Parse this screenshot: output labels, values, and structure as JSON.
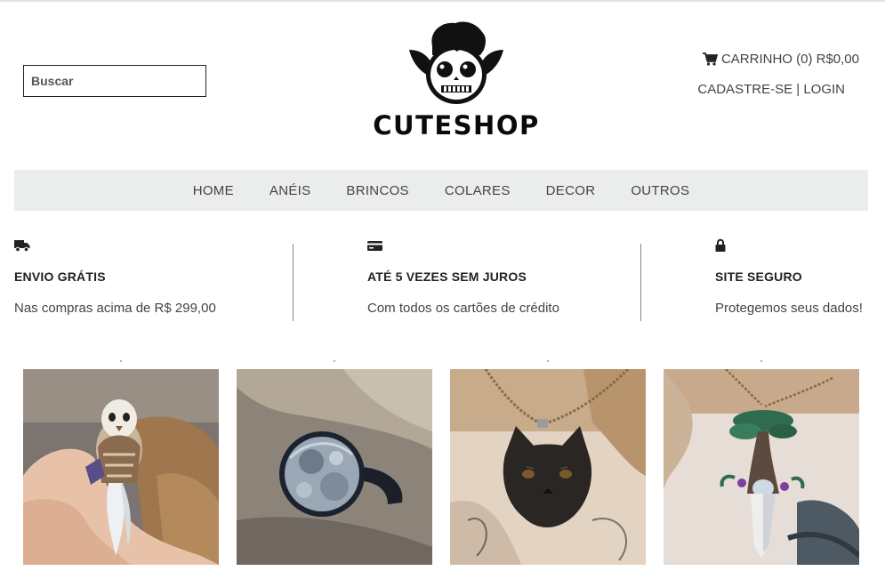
{
  "search": {
    "placeholder": "Buscar"
  },
  "brand": {
    "name": "CUTESHOP"
  },
  "header": {
    "cart_label": "CARRINHO (0) R$0,00",
    "register_label": "CADASTRE-SE",
    "separator": " | ",
    "login_label": "LOGIN"
  },
  "nav": {
    "items": [
      {
        "label": "HOME"
      },
      {
        "label": "ANÉIS"
      },
      {
        "label": "BRINCOS"
      },
      {
        "label": "COLARES"
      },
      {
        "label": "DECOR"
      },
      {
        "label": "OUTROS"
      }
    ]
  },
  "features": [
    {
      "icon": "truck-icon",
      "title": "ENVIO GRÁTIS",
      "description": "Nas compras acima de R$ 299,00"
    },
    {
      "icon": "credit-card-icon",
      "title": "ATÉ 5 VEZES SEM JUROS",
      "description": "Com todos os cartões de crédito"
    },
    {
      "icon": "lock-icon",
      "title": "SITE SEGURO",
      "description": "Protegemos seus dados!"
    }
  ],
  "products": [
    {
      "image": "owl-pendant-photo"
    },
    {
      "image": "moon-ring-photo"
    },
    {
      "image": "black-cat-necklace-photo"
    },
    {
      "image": "tree-pendant-photo"
    }
  ],
  "colors": {
    "nav_background": "#ebeded",
    "text": "#444444",
    "heading": "#222222"
  }
}
